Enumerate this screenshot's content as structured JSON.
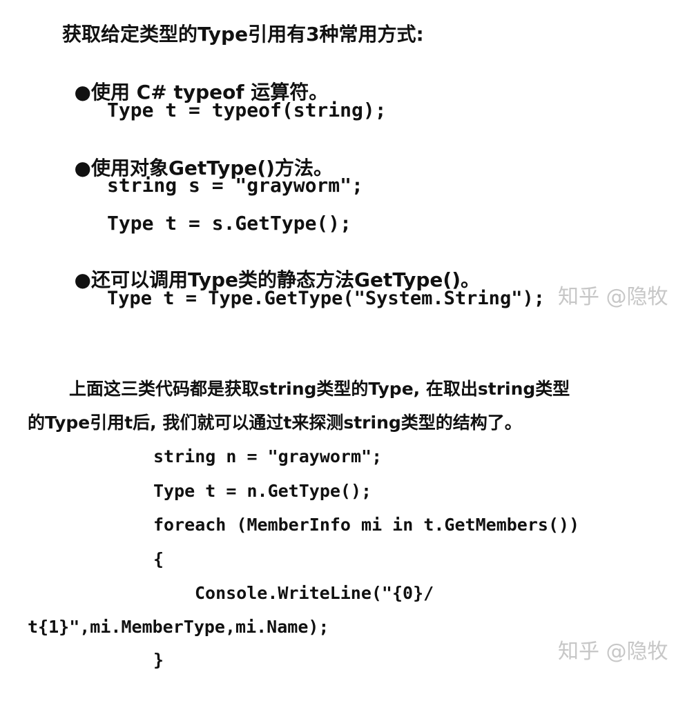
{
  "section1": {
    "intro": "获取给定类型的Type引用有3种常用方式:",
    "items": [
      {
        "bullet": "●",
        "text": "使用 C# typeof 运算符。",
        "code": [
          "Type t = typeof(string);"
        ]
      },
      {
        "bullet": "●",
        "text": "使用对象GetType()方法。",
        "code": [
          "string s = \"grayworm\";",
          "Type t = s.GetType();"
        ]
      },
      {
        "bullet": "●",
        "text": "还可以调用Type类的静态方法GetType()。",
        "code": [
          "Type t = Type.GetType(\"System.String\");"
        ]
      }
    ]
  },
  "section2": {
    "para_line1": "上面这三类代码都是获取string类型的Type, 在取出string类型",
    "para_line2": "的Type引用t后, 我们就可以通过t来探测string类型的结构了。",
    "code": [
      "string n = \"grayworm\";",
      "Type t = n.GetType();",
      "foreach (MemberInfo mi in t.GetMembers())",
      "{",
      "Console.WriteLine(\"{0}/",
      "t{1}\",mi.MemberType,mi.Name);",
      "}"
    ]
  },
  "watermarks": [
    "知乎 @隐牧",
    "知乎 @隐牧"
  ]
}
